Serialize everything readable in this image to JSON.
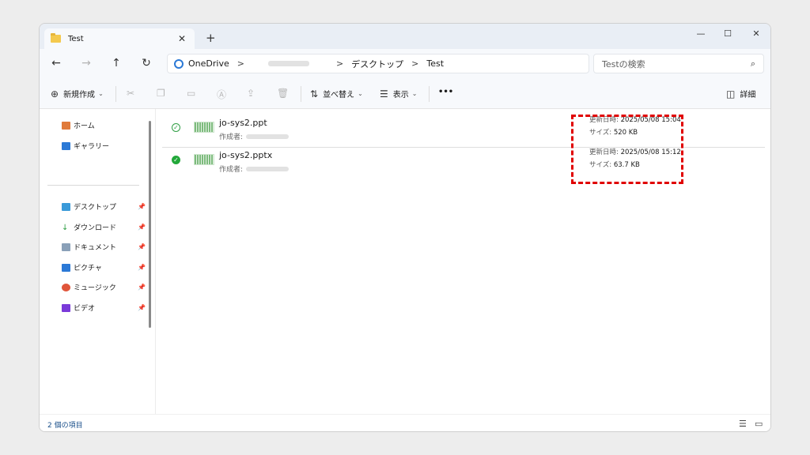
{
  "tab": {
    "title": "Test",
    "close": "✕",
    "new": "+"
  },
  "window_controls": {
    "minimize": "—",
    "maximize": "☐",
    "close": "✕"
  },
  "nav": {
    "back": "←",
    "forward": "→",
    "up": "↑",
    "refresh": "↻"
  },
  "breadcrumb": {
    "root": "OneDrive",
    "sep": ">",
    "items": [
      "デスクトップ",
      "Test"
    ]
  },
  "search": {
    "placeholder": "Testの検索",
    "icon": "⌕"
  },
  "toolbar": {
    "new_label": "新規作成",
    "sort_label": "並べ替え",
    "view_label": "表示",
    "more": "•••",
    "details_label": "詳細"
  },
  "sidebar": {
    "items": [
      {
        "label": "ホーム",
        "color": "#e07a3a"
      },
      {
        "label": "ギャラリー",
        "color": "#2b79d6"
      }
    ],
    "quick": [
      {
        "label": "デスクトップ",
        "color": "#3a9ad9"
      },
      {
        "label": "ダウンロード",
        "color": "#2f9e44"
      },
      {
        "label": "ドキュメント",
        "color": "#8aa0b8"
      },
      {
        "label": "ピクチャ",
        "color": "#2b79d6"
      },
      {
        "label": "ミュージック",
        "color": "#e0553a"
      },
      {
        "label": "ビデオ",
        "color": "#7a3ad9"
      }
    ]
  },
  "files": [
    {
      "name": "jo-sys2.ppt",
      "author_label": "作成者:",
      "modified_label": "更新日時:",
      "modified": "2025/05/08 15:04",
      "size_label": "サイズ:",
      "size": "520 KB",
      "status_icon": "✓"
    },
    {
      "name": "jo-sys2.pptx",
      "author_label": "作成者:",
      "modified_label": "更新日時:",
      "modified": "2025/05/08 15:12",
      "size_label": "サイズ:",
      "size": "63.7 KB",
      "status_icon": "✓"
    }
  ],
  "statusbar": {
    "count": "2 個の項目"
  }
}
